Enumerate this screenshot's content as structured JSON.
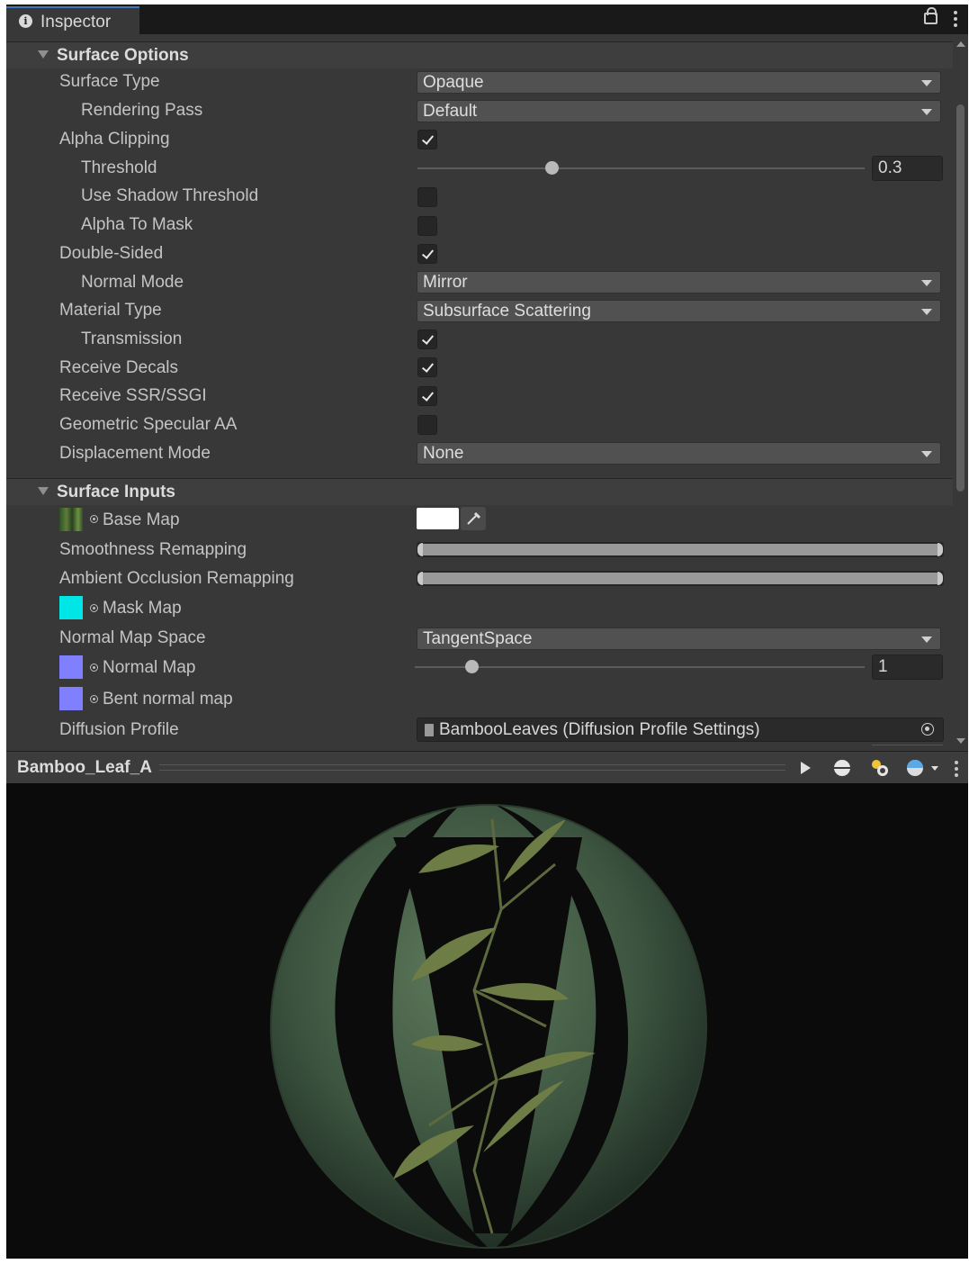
{
  "window": {
    "tab_label": "Inspector"
  },
  "sections": {
    "surface_options": "Surface Options",
    "surface_inputs": "Surface Inputs"
  },
  "surface_options": {
    "surface_type": {
      "label": "Surface Type",
      "value": "Opaque"
    },
    "rendering_pass": {
      "label": "Rendering Pass",
      "value": "Default"
    },
    "alpha_clipping": {
      "label": "Alpha Clipping",
      "checked": true
    },
    "threshold": {
      "label": "Threshold",
      "value": "0.3",
      "slider_fraction": 0.3
    },
    "use_shadow_threshold": {
      "label": "Use Shadow Threshold",
      "checked": false
    },
    "alpha_to_mask": {
      "label": "Alpha To Mask",
      "checked": false
    },
    "double_sided": {
      "label": "Double-Sided",
      "checked": true
    },
    "normal_mode": {
      "label": "Normal Mode",
      "value": "Mirror"
    },
    "material_type": {
      "label": "Material Type",
      "value": "Subsurface Scattering"
    },
    "transmission": {
      "label": "Transmission",
      "checked": true
    },
    "receive_decals": {
      "label": "Receive Decals",
      "checked": true
    },
    "receive_ssr": {
      "label": "Receive SSR/SSGI",
      "checked": true
    },
    "geometric_specular_aa": {
      "label": "Geometric Specular AA",
      "checked": false
    },
    "displacement_mode": {
      "label": "Displacement Mode",
      "value": "None"
    }
  },
  "surface_inputs": {
    "base_map": {
      "label": "Base Map",
      "color": "#ffffff"
    },
    "smoothness_remapping": {
      "label": "Smoothness Remapping"
    },
    "ao_remapping": {
      "label": "Ambient Occlusion Remapping"
    },
    "mask_map": {
      "label": "Mask Map",
      "swatch": "#00e6e6"
    },
    "normal_map_space": {
      "label": "Normal Map Space",
      "value": "TangentSpace"
    },
    "normal_map": {
      "label": "Normal Map",
      "value": "1",
      "swatch": "#8080ff",
      "slider_fraction": 0.125
    },
    "bent_normal_map": {
      "label": "Bent normal map",
      "swatch": "#8080ff"
    },
    "diffusion_profile": {
      "label": "Diffusion Profile",
      "value": "BambooLeaves (Diffusion Profile Settings)"
    }
  },
  "preview": {
    "title": "Bamboo_Leaf_A"
  },
  "colors": {
    "panel": "#383838",
    "tab_accent": "#3a79bb",
    "preview_bg": "#0b0b0b"
  }
}
